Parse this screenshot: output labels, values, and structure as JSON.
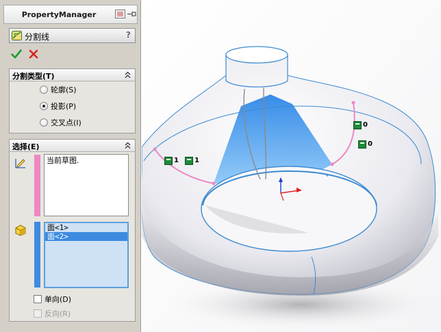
{
  "panel": {
    "title": "PropertyManager",
    "feature_title": "分割线",
    "help": "?",
    "ok_icon": "check-icon",
    "cancel_icon": "x-icon"
  },
  "split_type": {
    "header": "分割类型(T)",
    "options": [
      "轮廓(S)",
      "投影(P)",
      "交叉点(I)"
    ],
    "selected": "投影(P)"
  },
  "selection": {
    "header": "选择(E)",
    "sketch_value": "当前草图.",
    "faces": [
      "面<1>",
      "面<2>"
    ],
    "selected_face": "面<2>",
    "single_direction": "单向(D)",
    "reverse_direction": "反向(R)"
  },
  "graphics": {
    "tags": [
      {
        "label": "1"
      },
      {
        "label": "1"
      },
      {
        "label": "0"
      },
      {
        "label": "0"
      }
    ]
  },
  "colors": {
    "accent_blue": "#3d8be0",
    "face_highlight": "#4aa3ee",
    "pink": "#ee88c4",
    "tag_green": "#1f8a3a"
  }
}
